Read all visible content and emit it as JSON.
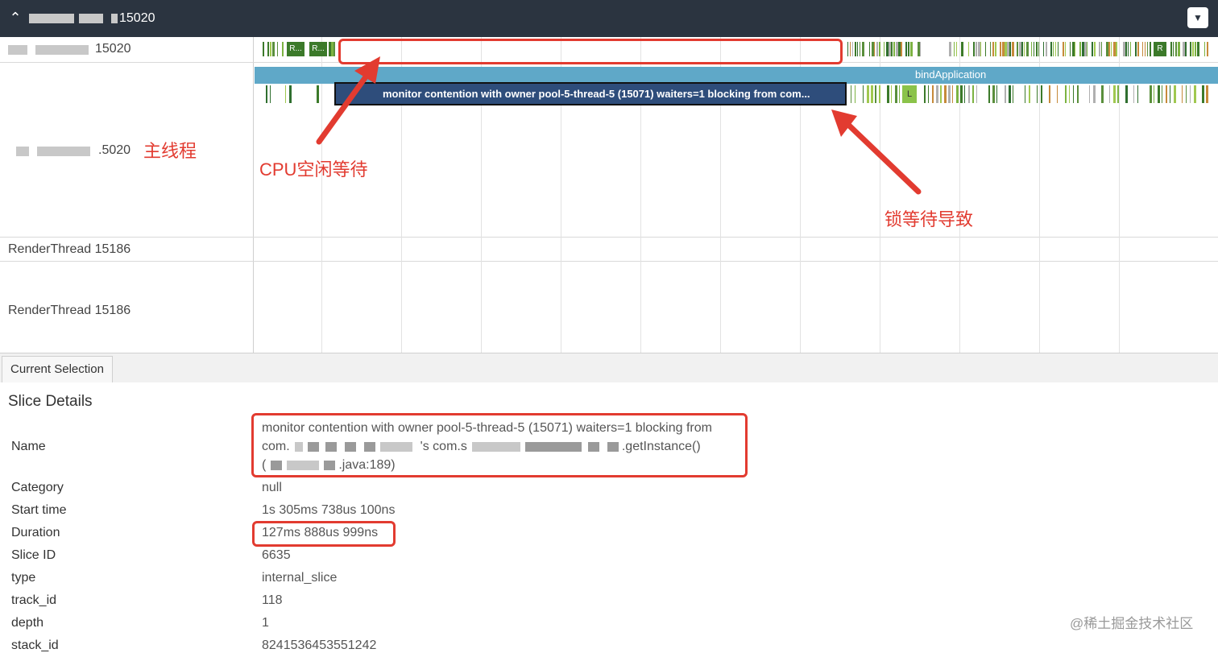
{
  "header": {
    "process_suffix": "15020",
    "collapse_icon": "chevron-up-icon",
    "expand_icon": "chevron-down-icon",
    "bg_color": "#2b3440"
  },
  "tracks": {
    "process_row_label": "15020",
    "main_thread_label": ".5020",
    "render_thread_1": "RenderThread 15186",
    "render_thread_2": "RenderThread 15186",
    "slice_labels": [
      "R...",
      "R...",
      "R"
    ],
    "bind_application": "bindApplication",
    "monitor_slice": "monitor contention with owner pool-5-thread-5 (15071) waiters=1 blocking from com...",
    "l_marker": "L"
  },
  "annotations": {
    "main_thread": "主线程",
    "cpu_idle": "CPU空闲等待",
    "lock_wait": "锁等待导致"
  },
  "tabs": {
    "current": "Current Selection"
  },
  "details": {
    "heading": "Slice Details",
    "rows": [
      {
        "label": "Name",
        "value_line1": "monitor contention with owner pool-5-thread-5 (15071) waiters=1 blocking from",
        "value_line2_a": "com.",
        "value_line2_b": "'s com.s",
        "value_line2_c": ".getInstance()",
        "value_line3_a": "(",
        "value_line3_b": ".java:189)"
      },
      {
        "label": "Category",
        "value": "null"
      },
      {
        "label": "Start time",
        "value": "1s 305ms 738us 100ns"
      },
      {
        "label": "Duration",
        "value": "127ms 888us 999ns"
      },
      {
        "label": "Slice ID",
        "value": "6635"
      },
      {
        "label": "type",
        "value": "internal_slice"
      },
      {
        "label": "track_id",
        "value": "118"
      },
      {
        "label": "depth",
        "value": "1"
      },
      {
        "label": "stack_id",
        "value": "8241536453551242"
      }
    ]
  },
  "watermark": "@稀土掘金技术社区",
  "colors": {
    "accent_red": "#e23b30",
    "bind_app": "#5fa8c8",
    "monitor_slice": "#2e4d7b"
  }
}
